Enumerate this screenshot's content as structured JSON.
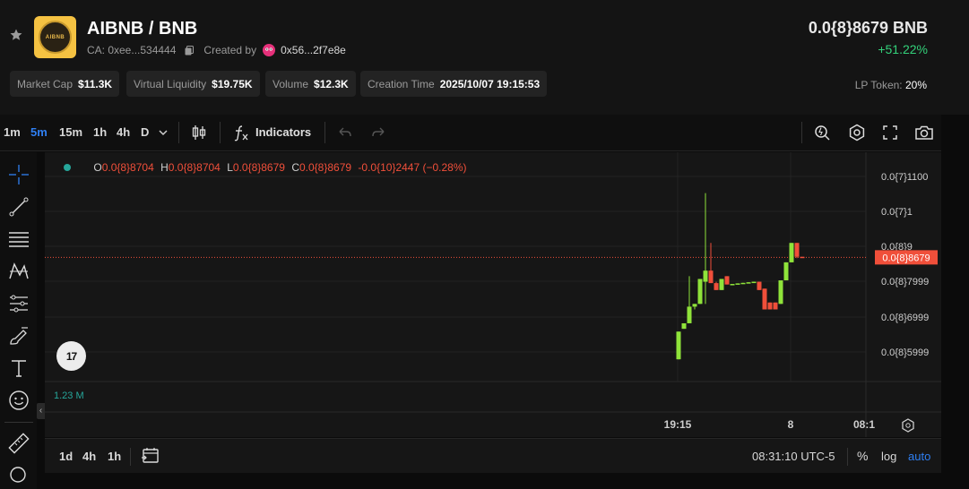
{
  "header": {
    "pair": "AIBNB / BNB",
    "logo_text": "AIBNB",
    "ca_label": "CA: 0xee...534444",
    "created_by_label": "Created by",
    "creator": "0x56...2f7e8e",
    "price": "0.0{8}8679 BNB",
    "change": "+51.22%",
    "stats": [
      {
        "label": "Market Cap",
        "value": "$11.3K"
      },
      {
        "label": "Virtual Liquidity",
        "value": "$19.75K"
      },
      {
        "label": "Volume",
        "value": "$12.3K"
      },
      {
        "label": "Creation Time",
        "value": "2025/10/07 19:15:53"
      }
    ],
    "lp_label": "LP Token:",
    "lp_value": "20%"
  },
  "toolbar": {
    "timeframes": [
      "1m",
      "5m",
      "15m",
      "1h",
      "4h",
      "D"
    ],
    "active_timeframe": "5m",
    "indicators_label": "Indicators"
  },
  "chart": {
    "ohlc": {
      "o_label": "O",
      "o": "0.0{8}8704",
      "h_label": "H",
      "h": "0.0{8}8704",
      "l_label": "L",
      "l": "0.0{8}8679",
      "c_label": "C",
      "c": "0.0{8}8679",
      "change": "-0.0{10}2447 (−0.28%)"
    },
    "volume_label": "1.23 M",
    "tv_logo": "17",
    "collapse_glyph": "‹",
    "y_ticks": [
      "0.0{7}1100",
      "0.0{7}1",
      "0.0{8}9",
      "0.0{8}7999",
      "0.0{8}6999",
      "0.0{8}5999"
    ],
    "current_price_label": "0.0{8}8679",
    "x_ticks": [
      "19:15",
      "8",
      "08:1"
    ],
    "colors": {
      "up": "#8fe33a",
      "down": "#f04f3a",
      "price_line": "#f04f3a"
    }
  },
  "chart_data": {
    "type": "candlestick",
    "ylim": [
      5.2e-09,
      1.16e-08
    ],
    "candles": [
      {
        "o": 5e-09,
        "h": 6e-09,
        "l": 5e-09,
        "c": 6e-09
      },
      {
        "o": 6.1e-09,
        "h": 6.3e-09,
        "l": 6.1e-09,
        "c": 6.3e-09
      },
      {
        "o": 6.3e-09,
        "h": 8e-09,
        "l": 6.3e-09,
        "c": 6.9e-09
      },
      {
        "o": 6.9e-09,
        "h": 7e-09,
        "l": 6.8e-09,
        "c": 7e-09
      },
      {
        "o": 7e-09,
        "h": 7.9e-09,
        "l": 7e-09,
        "c": 7.9e-09
      },
      {
        "o": 7.8e-09,
        "h": 1.1e-08,
        "l": 7e-09,
        "c": 8.2e-09
      },
      {
        "o": 8.2e-09,
        "h": 9.2e-09,
        "l": 7.8e-09,
        "c": 7.75e-09
      },
      {
        "o": 7.75e-09,
        "h": 7.8e-09,
        "l": 7.5e-09,
        "c": 7.5e-09
      },
      {
        "o": 7.5e-09,
        "h": 7.9e-09,
        "l": 7.5e-09,
        "c": 7.9e-09
      },
      {
        "o": 8e-09,
        "h": 8e-09,
        "l": 7.7e-09,
        "c": 7.7e-09
      },
      {
        "o": 7.7e-09,
        "h": 7.72e-09,
        "l": 7.7e-09,
        "c": 7.72e-09
      },
      {
        "o": 7.72e-09,
        "h": 7.74e-09,
        "l": 7.72e-09,
        "c": 7.74e-09
      },
      {
        "o": 7.74e-09,
        "h": 7.76e-09,
        "l": 7.74e-09,
        "c": 7.76e-09
      },
      {
        "o": 7.76e-09,
        "h": 7.78e-09,
        "l": 7.76e-09,
        "c": 7.78e-09
      },
      {
        "o": 7.78e-09,
        "h": 7.8e-09,
        "l": 7.78e-09,
        "c": 7.8e-09
      },
      {
        "o": 7.8e-09,
        "h": 7.8e-09,
        "l": 7.5e-09,
        "c": 7.5e-09
      },
      {
        "o": 7.55e-09,
        "h": 7.55e-09,
        "l": 6.8e-09,
        "c": 6.8e-09
      },
      {
        "o": 7.05e-09,
        "h": 7.05e-09,
        "l": 6.8e-09,
        "c": 6.8e-09
      },
      {
        "o": 7.05e-09,
        "h": 7.05e-09,
        "l": 6.8e-09,
        "c": 6.8e-09
      },
      {
        "o": 7e-09,
        "h": 7.85e-09,
        "l": 7e-09,
        "c": 7.85e-09
      },
      {
        "o": 7.85e-09,
        "h": 8.5e-09,
        "l": 7.85e-09,
        "c": 8.5e-09
      },
      {
        "o": 8.5e-09,
        "h": 9.2e-09,
        "l": 8.5e-09,
        "c": 9.2e-09
      },
      {
        "o": 9.2e-09,
        "h": 9.2e-09,
        "l": 8.65e-09,
        "c": 8.7e-09
      },
      {
        "o": 8.7e-09,
        "h": 8.7e-09,
        "l": 8.67e-09,
        "c": 8.68e-09
      }
    ],
    "current_price": 8.679e-09
  },
  "bottombar": {
    "ranges": [
      "1d",
      "4h",
      "1h"
    ],
    "clock": "08:31:10 UTC-5",
    "pct": "%",
    "log": "log",
    "auto": "auto"
  }
}
